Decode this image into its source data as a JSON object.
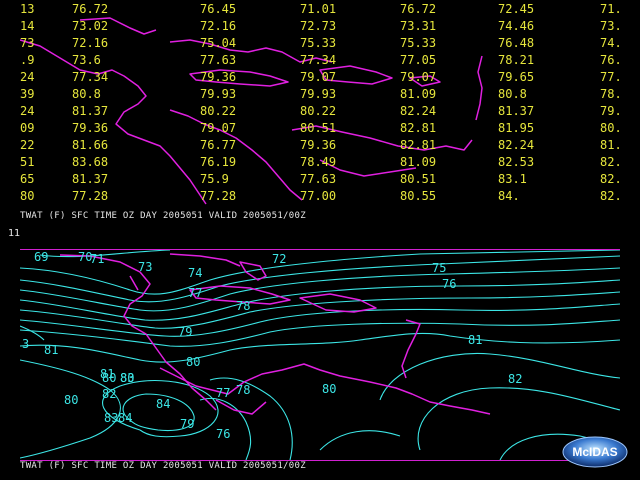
{
  "top_panel": {
    "caption": "TWAT (F) SFC TIME OZ DAY 2005051 VALID 2005051/00Z",
    "grid_rows": [
      [
        "13",
        "76.72",
        "76.45",
        "71.01",
        "76.72",
        "72.45",
        "71."
      ],
      [
        "14",
        "73.02",
        "72.16",
        "72.73",
        "73.31",
        "74.46",
        "73."
      ],
      [
        "73",
        "72.16",
        "75.04",
        "75.33",
        "75.33",
        "76.48",
        "74."
      ],
      [
        ".9",
        "73.6",
        "77.63",
        "77.34",
        "77.05",
        "78.21",
        "76."
      ],
      [
        "24",
        "77.34",
        "79.36",
        "79.07",
        "79.07",
        "79.65",
        "77."
      ],
      [
        "39",
        "80.8",
        "79.93",
        "79.93",
        "81.09",
        "80.8",
        "78."
      ],
      [
        "24",
        "81.37",
        "80.22",
        "80.22",
        "82.24",
        "81.37",
        "79."
      ],
      [
        "09",
        "79.36",
        "79.07",
        "80.51",
        "82.81",
        "81.95",
        "80."
      ],
      [
        "22",
        "81.66",
        "76.77",
        "79.36",
        "82.81",
        "82.24",
        "81."
      ],
      [
        "51",
        "83.68",
        "76.19",
        "78.49",
        "81.09",
        "82.53",
        "82."
      ],
      [
        "65",
        "81.37",
        "75.9",
        "77.63",
        "80.51",
        "83.1",
        "82."
      ],
      [
        "80",
        "77.28",
        "77.28",
        "77.00",
        "80.55",
        "84.",
        "82."
      ]
    ]
  },
  "frame_number": "11",
  "bottom_panel": {
    "caption": "TWAT (F) SFC TIME OZ DAY 2005051 VALID 2005051/00Z",
    "contour_labels": [
      "69",
      "70",
      "71",
      "72",
      "73",
      "74",
      "75",
      "76",
      "77",
      "78",
      "79",
      "80",
      "81",
      "82",
      "83",
      "84",
      "3",
      "80",
      "80",
      "81",
      "80",
      "79",
      "78",
      "77",
      "76",
      "83",
      "82",
      "81",
      "84",
      "80"
    ]
  },
  "colors": {
    "background": "#000000",
    "grid_values": "#e6e63c",
    "contours": "#3ce6e6",
    "coastlines": "#e020e0",
    "caption": "#e6e6e6"
  },
  "logo": {
    "text": "McIDAS"
  }
}
